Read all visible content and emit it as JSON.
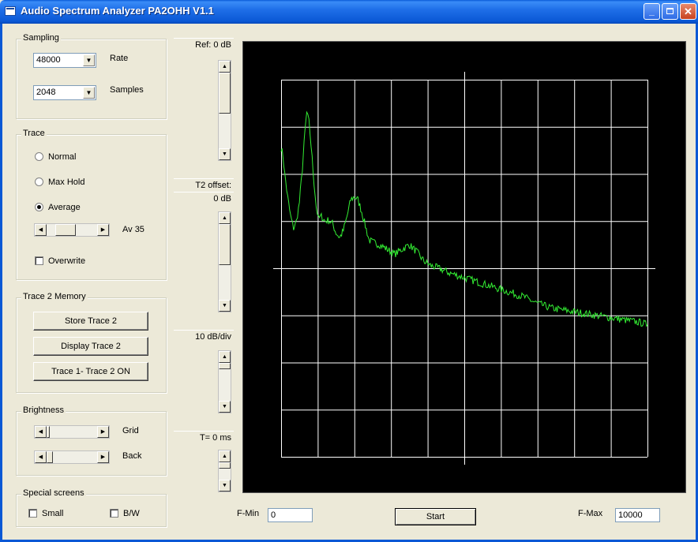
{
  "window": {
    "title": "Audio Spectrum Analyzer PA2OHH V1.1",
    "controls": [
      "minimize",
      "maximize",
      "close"
    ]
  },
  "sampling": {
    "group_title": "Sampling",
    "rate_value": "48000",
    "rate_label": "Rate",
    "samples_value": "2048",
    "samples_label": "Samples"
  },
  "trace": {
    "group_title": "Trace",
    "normal_label": "Normal",
    "maxhold_label": "Max Hold",
    "average_label": "Average",
    "selected": "Average",
    "average_count_label": "Av 35",
    "average_slider_fraction": 0.3,
    "overwrite_label": "Overwrite",
    "overwrite_checked": false
  },
  "trace2": {
    "group_title": "Trace 2 Memory",
    "store_label": "Store Trace 2",
    "display_label": "Display Trace 2",
    "diff_label": "Trace 1- Trace 2 ON"
  },
  "brightness": {
    "group_title": "Brightness",
    "grid_label": "Grid",
    "grid_fraction": 0.0,
    "back_label": "Back",
    "back_fraction": 0.0
  },
  "special": {
    "group_title": "Special screens",
    "small_label": "Small",
    "bw_label": "B/W"
  },
  "readouts": {
    "ref": "Ref: 0 dB",
    "t2offset_line1": "T2 offset:",
    "t2offset_line2": "0 dB",
    "dbdiv": "10 dB/div",
    "time": "T= 0 ms"
  },
  "bottom": {
    "fmin_label": "F-Min",
    "fmin_value": "0",
    "start_label": "Start",
    "fmax_label": "F-Max",
    "fmax_value": "10000"
  },
  "colors": {
    "trace": "#33ee33",
    "grid": "#ffffff",
    "screen": "#000000",
    "titlebar": "#0a58d5"
  },
  "chart_data": {
    "type": "line",
    "grid_divisions_x": 10,
    "grid_divisions_y": 8,
    "x_range_hz": [
      0,
      10000
    ],
    "y_unit": "dB",
    "ref_db": 0,
    "db_per_div": 10,
    "series": [
      {
        "points": [
          [
            0,
            -14.5
          ],
          [
            50,
            -16
          ],
          [
            100,
            -20
          ],
          [
            180,
            -25
          ],
          [
            260,
            -29
          ],
          [
            340,
            -31.5
          ],
          [
            420,
            -30
          ],
          [
            500,
            -26
          ],
          [
            580,
            -19
          ],
          [
            650,
            -11
          ],
          [
            700,
            -7
          ],
          [
            760,
            -9
          ],
          [
            820,
            -14
          ],
          [
            900,
            -22
          ],
          [
            960,
            -27
          ],
          [
            1020,
            -29.5
          ],
          [
            1100,
            -29
          ],
          [
            1200,
            -30
          ],
          [
            1300,
            -29.8
          ],
          [
            1400,
            -30.5
          ],
          [
            1500,
            -32.5
          ],
          [
            1600,
            -33.5
          ],
          [
            1700,
            -32
          ],
          [
            1800,
            -29
          ],
          [
            1900,
            -25.5
          ],
          [
            2000,
            -24.8
          ],
          [
            2100,
            -25.5
          ],
          [
            2200,
            -28
          ],
          [
            2300,
            -31
          ],
          [
            2400,
            -34
          ],
          [
            2500,
            -34.5
          ],
          [
            2700,
            -35
          ],
          [
            2900,
            -36
          ],
          [
            3100,
            -37
          ],
          [
            3300,
            -36
          ],
          [
            3500,
            -35
          ],
          [
            3700,
            -36.5
          ],
          [
            3900,
            -38.5
          ],
          [
            4100,
            -39.5
          ],
          [
            4300,
            -40
          ],
          [
            4600,
            -41
          ],
          [
            5000,
            -42
          ],
          [
            5400,
            -43
          ],
          [
            5800,
            -44
          ],
          [
            6200,
            -45
          ],
          [
            6600,
            -46
          ],
          [
            7000,
            -47.5
          ],
          [
            7400,
            -48.5
          ],
          [
            7800,
            -49
          ],
          [
            8200,
            -49.5
          ],
          [
            8600,
            -50
          ],
          [
            9000,
            -50.5
          ],
          [
            9400,
            -51
          ],
          [
            9800,
            -51.5
          ],
          [
            10000,
            -52
          ]
        ]
      }
    ]
  }
}
